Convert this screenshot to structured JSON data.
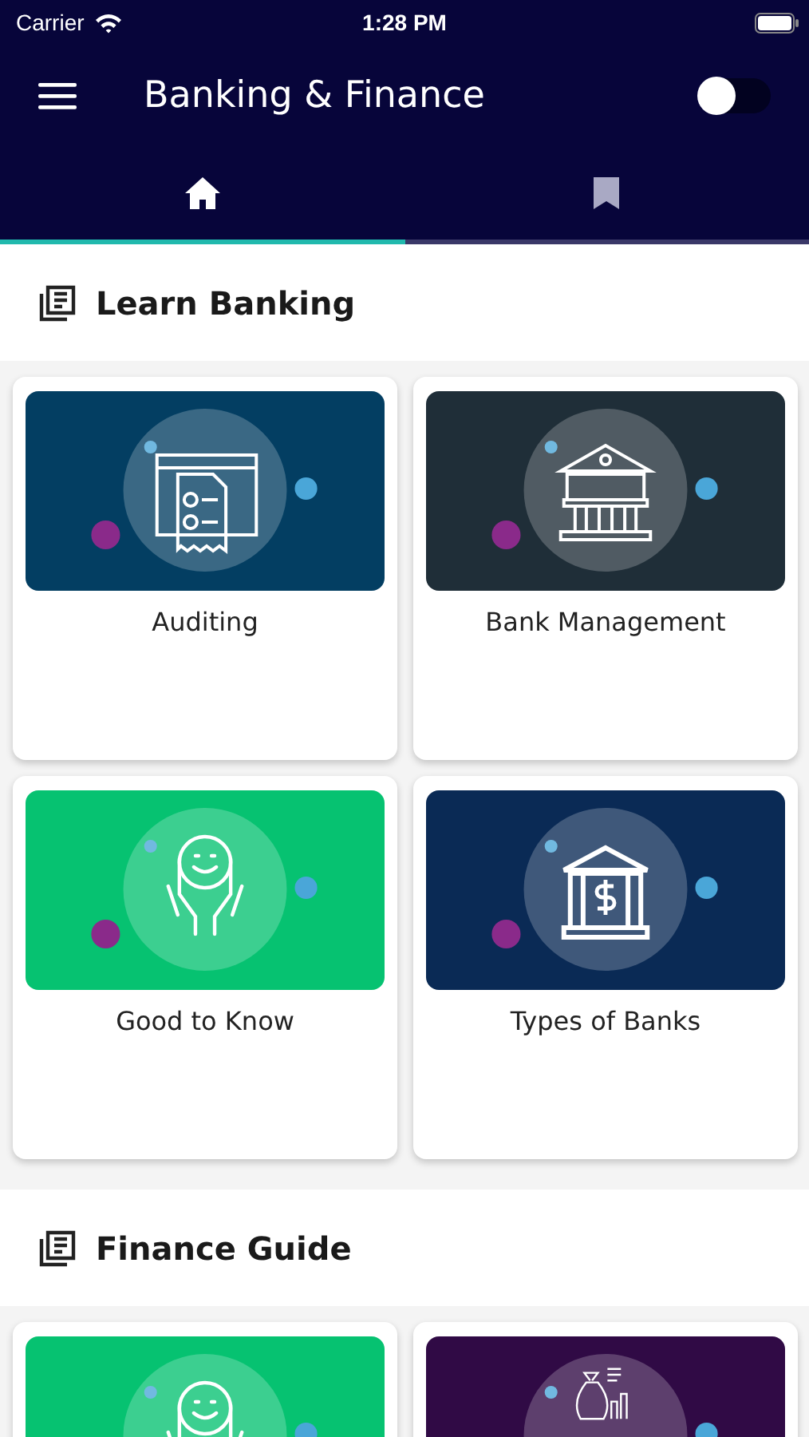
{
  "status_bar": {
    "carrier": "Carrier",
    "time": "1:28 PM"
  },
  "app_bar": {
    "title": "Banking & Finance",
    "toggle": {
      "on": false
    }
  },
  "tabs": [
    {
      "kind": "home",
      "selected": true
    },
    {
      "kind": "bookmark",
      "selected": false
    }
  ],
  "sections": [
    {
      "title": "Learn Banking",
      "cards": [
        {
          "title": "Auditing",
          "kind": "checklist",
          "color": "#033e62"
        },
        {
          "title": "Bank Management",
          "kind": "bank",
          "color": "#1f2e38"
        },
        {
          "title": "Good to Know",
          "kind": "smile",
          "color": "#06c271"
        },
        {
          "title": "Types of Banks",
          "kind": "dollar-bank",
          "color": "#0a2a55"
        }
      ]
    },
    {
      "title": "Finance Guide",
      "cards": [
        {
          "kind": "smile",
          "color": "#06c271"
        },
        {
          "kind": "money-bag",
          "color": "#300a45"
        }
      ]
    }
  ]
}
